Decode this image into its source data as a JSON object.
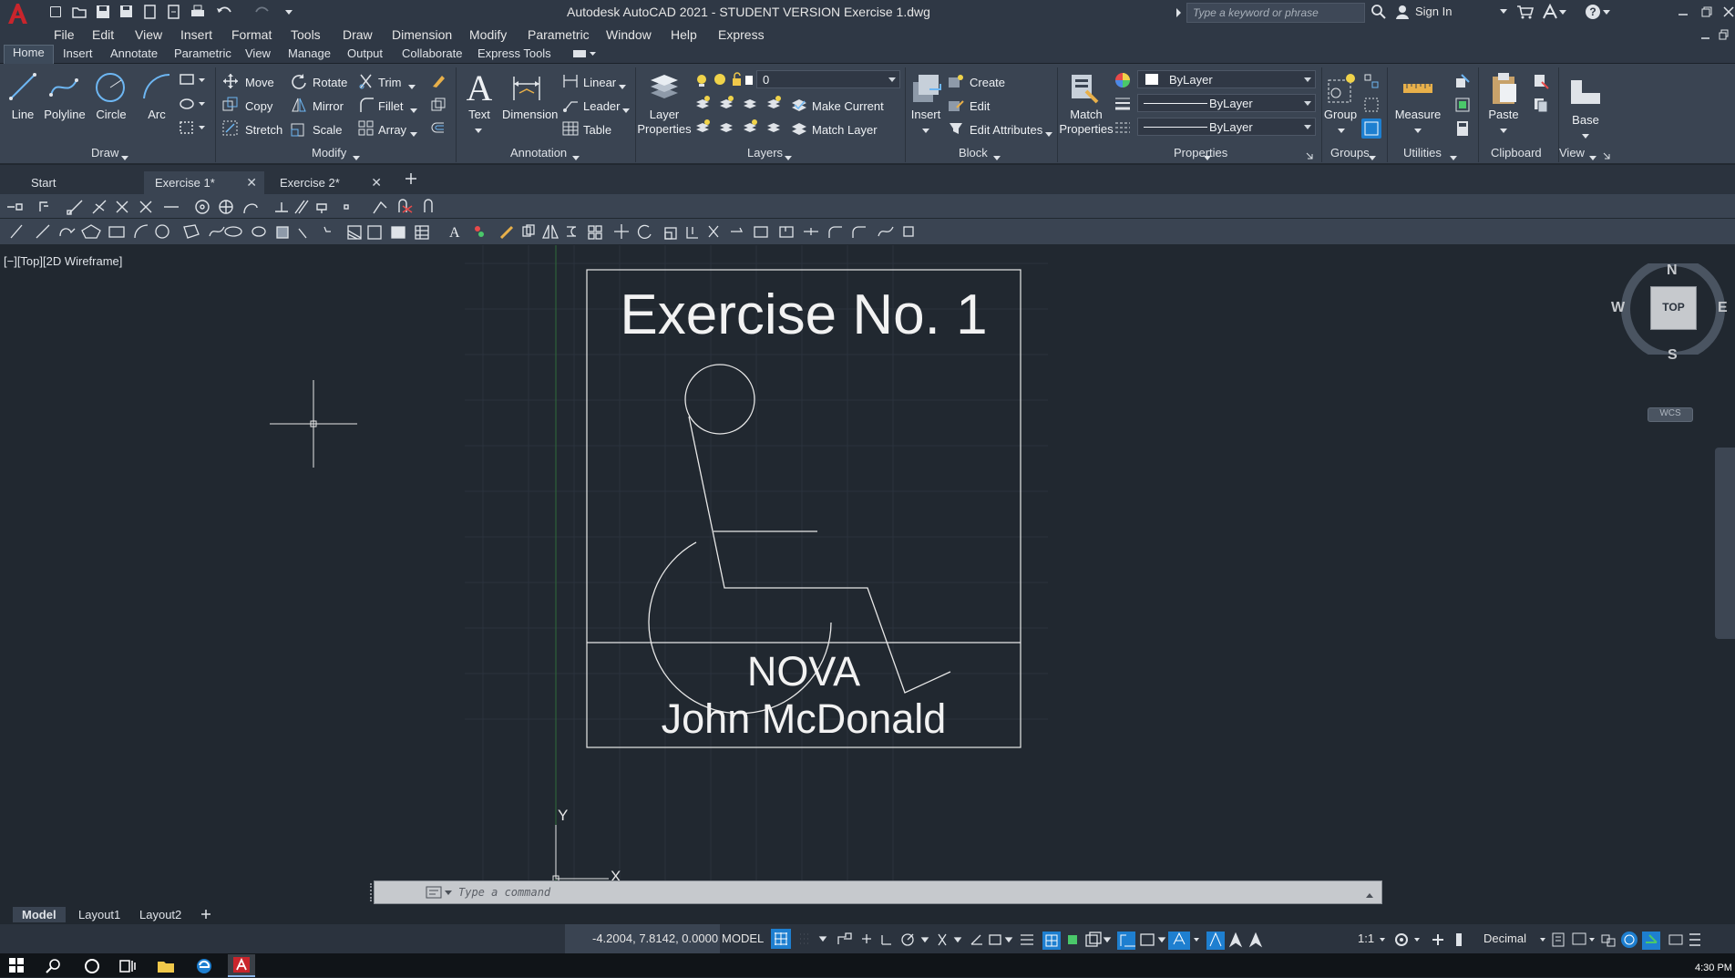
{
  "app": {
    "title": "Autodesk AutoCAD 2021 - STUDENT VERSION    Exercise 1.dwg",
    "search_placeholder": "Type a keyword or phrase",
    "sign_in": "Sign In"
  },
  "menubar": [
    "File",
    "Edit",
    "View",
    "Insert",
    "Format",
    "Tools",
    "Draw",
    "Dimension",
    "Modify",
    "Parametric",
    "Window",
    "Help",
    "Express"
  ],
  "ribbon_tabs": [
    "Home",
    "Insert",
    "Annotate",
    "Parametric",
    "View",
    "Manage",
    "Output",
    "Collaborate",
    "Express Tools"
  ],
  "ribbon": {
    "draw": {
      "line": "Line",
      "polyline": "Polyline",
      "circle": "Circle",
      "arc": "Arc",
      "panel": "Draw"
    },
    "modify": {
      "move": "Move",
      "rotate": "Rotate",
      "trim": "Trim",
      "copy": "Copy",
      "mirror": "Mirror",
      "fillet": "Fillet",
      "stretch": "Stretch",
      "scale": "Scale",
      "array": "Array",
      "panel": "Modify"
    },
    "annotation": {
      "text": "Text",
      "dimension": "Dimension",
      "linear": "Linear",
      "leader": "Leader",
      "table": "Table",
      "panel": "Annotation"
    },
    "layers": {
      "layer_properties": "Layer Properties",
      "current_layer": "0",
      "make_current": "Make Current",
      "match_layer": "Match Layer",
      "panel": "Layers"
    },
    "block": {
      "insert": "Insert",
      "create": "Create",
      "edit": "Edit",
      "edit_attributes": "Edit Attributes",
      "panel": "Block"
    },
    "properties": {
      "match_properties": "Match Properties",
      "color": "ByLayer",
      "linetype": "ByLayer",
      "lineweight": "ByLayer",
      "panel": "Properties"
    },
    "groups": {
      "group": "Group",
      "panel": "Groups"
    },
    "utilities": {
      "measure": "Measure",
      "panel": "Utilities"
    },
    "clipboard": {
      "paste": "Paste",
      "panel": "Clipboard"
    },
    "view": {
      "base": "Base",
      "panel": "View"
    }
  },
  "doc_tabs": [
    "Start",
    "Exercise 1*",
    "Exercise 2*"
  ],
  "viewport": {
    "label": "[−][Top][2D Wireframe]",
    "title_text": "Exercise No. 1",
    "line1": "NOVA",
    "line2": "John McDonald",
    "ucs_y": "Y",
    "ucs_x": "X"
  },
  "viewcube": {
    "n": "N",
    "s": "S",
    "e": "E",
    "w": "W",
    "top": "TOP",
    "wcs": "WCS"
  },
  "command": {
    "placeholder": "Type a command"
  },
  "layout_tabs": [
    "Model",
    "Layout1",
    "Layout2"
  ],
  "status": {
    "coords": "-4.2004, 7.8142, 0.0000",
    "model": "MODEL",
    "scale": "1:1",
    "units": "Decimal"
  },
  "taskbar": {
    "time": "4:30 PM"
  },
  "colors": {
    "accent": "#1e7fd0",
    "autocad_red": "#c9252c",
    "canvas": "#212830",
    "ribbon": "#3a4452"
  }
}
